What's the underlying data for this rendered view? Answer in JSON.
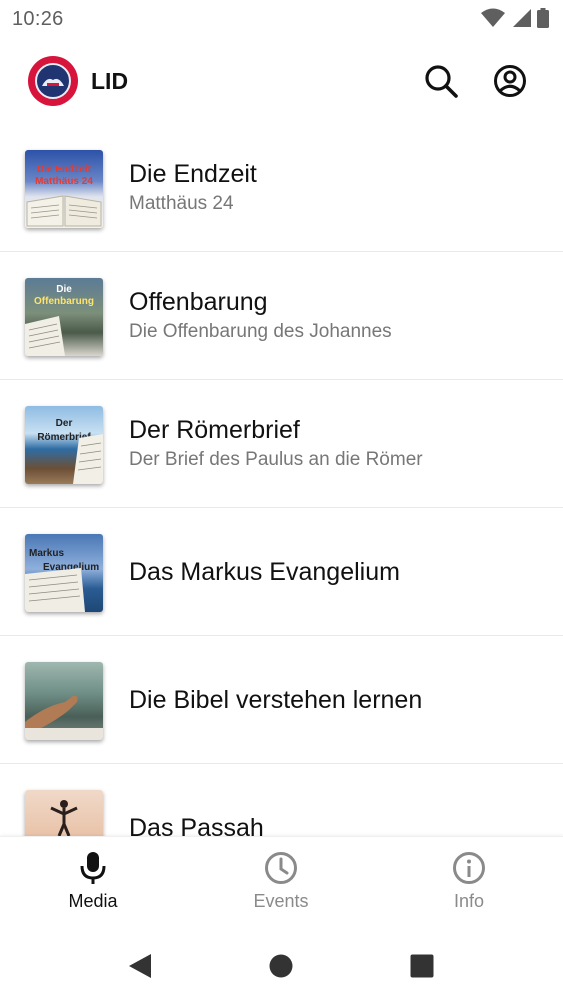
{
  "status_bar": {
    "time": "10:26",
    "icons": [
      "wifi-icon",
      "signal-icon",
      "battery-icon"
    ]
  },
  "app_bar": {
    "title": "LID",
    "logo_icon": "lid-logo",
    "search_icon": "search-icon",
    "account_icon": "account-circle-icon"
  },
  "colors": {
    "accent": "#d7143b",
    "logo_blue": "#1f3470",
    "subtitle": "#777777",
    "inactive_nav": "#8a8a8a"
  },
  "media_list": {
    "items": [
      {
        "title": "Die Endzeit",
        "subtitle": "Matthäus 24",
        "thumb_text": [
          "Die Endzeit",
          "Matthäus 24"
        ]
      },
      {
        "title": "Offenbarung",
        "subtitle": "Die Offenbarung des Johannes",
        "thumb_text": [
          "Die",
          "Offenbarung"
        ]
      },
      {
        "title": "Der Römerbrief",
        "subtitle": "Der Brief des Paulus an die Römer",
        "thumb_text": [
          "Der",
          "Römerbrief"
        ]
      },
      {
        "title": "Das Markus Evangelium",
        "subtitle": "",
        "thumb_text": [
          "Markus",
          "Evangelium"
        ]
      },
      {
        "title": "Die Bibel verstehen lernen",
        "subtitle": "",
        "thumb_text": []
      },
      {
        "title": "Das Passah",
        "subtitle": "",
        "thumb_text": []
      }
    ]
  },
  "bottom_nav": {
    "items": [
      {
        "label": "Media",
        "icon": "microphone-icon",
        "active": true
      },
      {
        "label": "Events",
        "icon": "clock-icon",
        "active": false
      },
      {
        "label": "Info",
        "icon": "info-icon",
        "active": false
      }
    ]
  },
  "system_nav": {
    "buttons": [
      "back-triangle-icon",
      "home-circle-icon",
      "recents-square-icon"
    ]
  }
}
